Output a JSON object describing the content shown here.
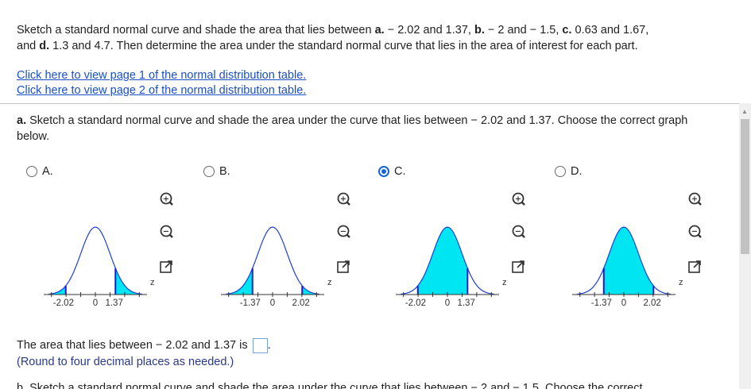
{
  "intro": {
    "p1": "Sketch a standard normal curve and shade the area that lies between ",
    "a_lbl": "a.",
    "a_txt": " − 2.02 and 1.37, ",
    "b_lbl": "b.",
    "b_txt": " − 2 and − 1.5, ",
    "c_lbl": "c.",
    "c_txt": " 0.63 and 1.67,",
    "p2": "and ",
    "d_lbl": "d.",
    "d_txt": " 1.3 and 4.7. Then determine the area under the standard normal curve that lies in the area of interest for each part."
  },
  "links": {
    "page1": "Click here to view page 1 of the normal distribution table.",
    "page2": "Click here to view page 2 of the normal distribution table."
  },
  "question": {
    "label": "a.",
    "text": " Sketch a standard normal curve and shade the area under the curve that lies between − 2.02 and 1.37. Choose the correct graph below."
  },
  "options": [
    {
      "letter": "A.",
      "selected": false,
      "ticks": [
        "-2.02",
        "0",
        "1.37"
      ],
      "z": "z"
    },
    {
      "letter": "B.",
      "selected": false,
      "ticks": [
        "-1.37",
        "0",
        "2.02"
      ],
      "z": "z"
    },
    {
      "letter": "C.",
      "selected": true,
      "ticks": [
        "-2.02",
        "0",
        "1.37"
      ],
      "z": "z"
    },
    {
      "letter": "D.",
      "selected": false,
      "ticks": [
        "-1.37",
        "0",
        "2.02"
      ],
      "z": "z"
    }
  ],
  "answer": {
    "text": "The area that lies between − 2.02 and 1.37 is",
    "value": "",
    "suffix": ".",
    "hint": "(Round to four decimal places as needed.)"
  },
  "next_partial": "b. Sketch a standard normal curve and shade the area under the curve that lies between − 2 and − 1.5. Choose the correct",
  "colors": {
    "shade": "#00e5f2",
    "accent": "#1a63d6",
    "link": "#1a4fc4",
    "curve": "#1c3fd8"
  },
  "icons": [
    "zoom-in-icon",
    "zoom-out-icon",
    "open-external-icon"
  ]
}
